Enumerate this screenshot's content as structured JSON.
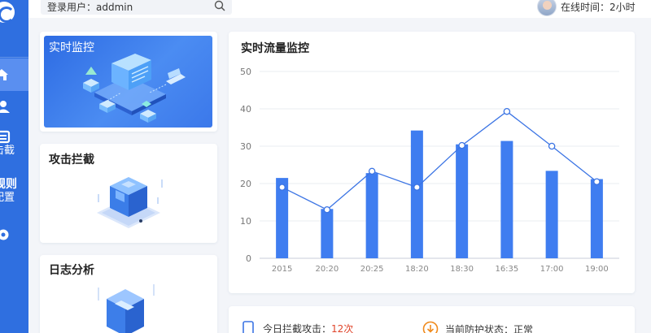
{
  "header": {
    "login_user": "登录用户：addmin",
    "online_time": "在线时间：2小时"
  },
  "sidebar": {
    "items": [
      {
        "icon": "home-icon"
      },
      {
        "icon": "user-icon"
      },
      {
        "icon": "list-icon",
        "label": "击截"
      },
      {
        "label_top": "规则",
        "label_bottom": "配置"
      },
      {
        "icon": "settings-icon"
      }
    ]
  },
  "cards": {
    "monitor": {
      "title": "实时监控"
    },
    "intercept": {
      "title": "攻击拦截"
    },
    "log": {
      "title": "日志分析"
    }
  },
  "chart": {
    "title": "实时流量监控"
  },
  "chart_data": {
    "type": "bar",
    "categories": [
      "2015",
      "20:20",
      "20:25",
      "18:20",
      "18:30",
      "16:35",
      "17:00",
      "19:00"
    ],
    "series": [
      {
        "type": "bar",
        "values": [
          21.5,
          13.2,
          22.8,
          34.2,
          30.5,
          31.4,
          23.4,
          21.2
        ]
      },
      {
        "type": "line",
        "values": [
          19.0,
          13.0,
          23.3,
          19.0,
          30.2,
          39.3,
          30.0,
          20.5
        ]
      }
    ],
    "ylim": [
      0,
      50
    ],
    "yticks": [
      0,
      10,
      20,
      30,
      40,
      50
    ],
    "grid": true,
    "colors": {
      "bar": "#3f7df0",
      "line": "#3b74e4"
    }
  },
  "status": {
    "today_label": "今日拦截攻击：",
    "today_value": "12次",
    "protect_label": "当前防护状态：",
    "protect_value": "正常"
  },
  "colors": {
    "sidebar": "#2f6fe0",
    "accent": "#3f7df0",
    "alert": "#e0452b"
  }
}
